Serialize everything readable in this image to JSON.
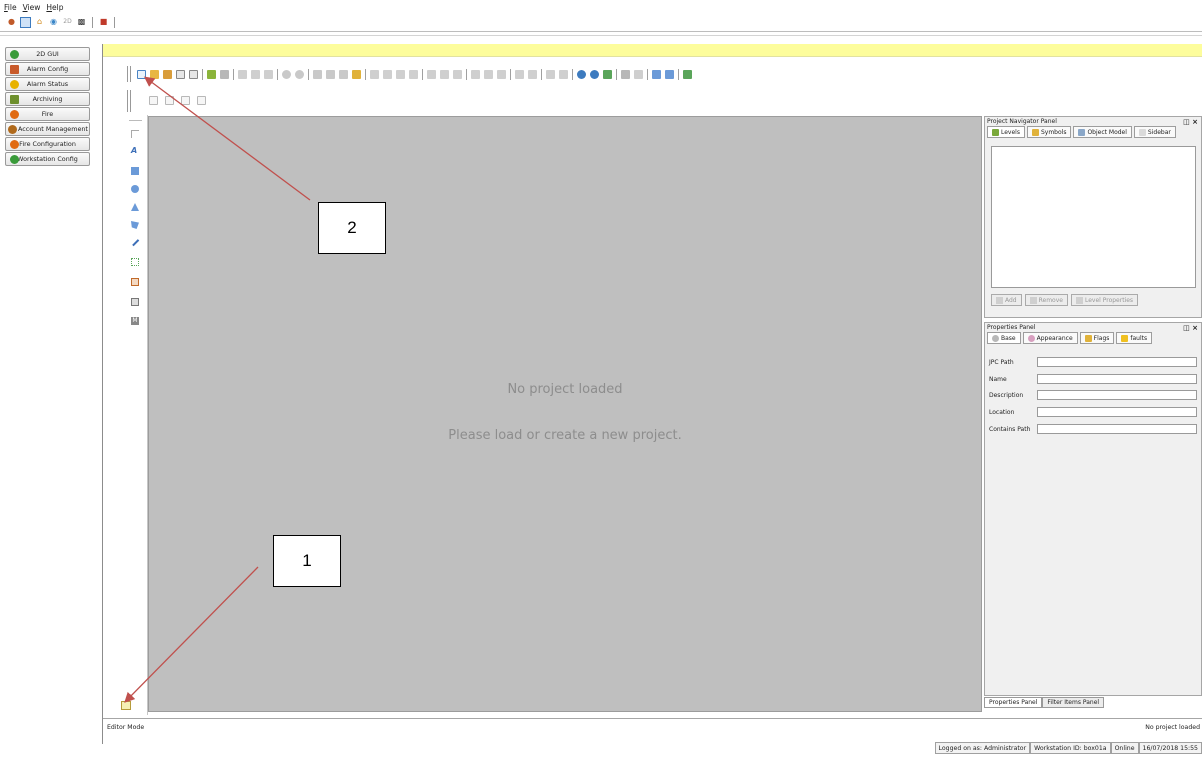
{
  "menubar": {
    "items": [
      "File",
      "View",
      "Help"
    ]
  },
  "system_toolbar": {
    "icons": [
      "user-icon",
      "monitor-icon",
      "home-icon",
      "globe-icon",
      "2d-icon",
      "binoculars-icon",
      "alarm-icon"
    ]
  },
  "nav": {
    "items": [
      {
        "label": "2D GUI",
        "icon": "globe-icon",
        "color": "#3a9b3a"
      },
      {
        "label": "Alarm Config",
        "icon": "wrench-icon",
        "color": "#c85a2a"
      },
      {
        "label": "Alarm Status",
        "icon": "star-icon",
        "color": "#e8b200"
      },
      {
        "label": "Archiving",
        "icon": "archive-icon",
        "color": "#6d8f2d"
      },
      {
        "label": "Fire",
        "icon": "fire-icon",
        "color": "#e06a12"
      },
      {
        "label": "Account Management",
        "icon": "users-icon",
        "color": "#b06a1c"
      },
      {
        "label": "Fire Configuration",
        "icon": "fire-icon",
        "color": "#e06a12"
      },
      {
        "label": "Workstation Config",
        "icon": "globe-icon",
        "color": "#3a9b3a"
      }
    ]
  },
  "canvas": {
    "message_title": "No project loaded",
    "message_body": "Please load or create a new project."
  },
  "navigator_panel": {
    "title": "Project Navigator Panel",
    "tabs": [
      "Levels",
      "Symbols",
      "Object Model",
      "Sidebar"
    ],
    "buttons": [
      "Add",
      "Remove",
      "Level Properties"
    ]
  },
  "properties_panel": {
    "title": "Properties Panel",
    "tabs": [
      "Base",
      "Appearance",
      "Flags",
      "faults"
    ],
    "fields": [
      {
        "label": "JPC Path",
        "value": ""
      },
      {
        "label": "Name",
        "value": ""
      },
      {
        "label": "Description",
        "value": ""
      },
      {
        "label": "Location",
        "value": ""
      },
      {
        "label": "Contains Path",
        "value": ""
      }
    ],
    "bottom_tabs": [
      "Properties Panel",
      "Filter Items Panel"
    ]
  },
  "status": {
    "mode": "Editor Mode",
    "project": "No project loaded",
    "logged_on": "Logged on as: Administrator",
    "workstation": "Workstation ID: box01a",
    "online": "Online",
    "datetime": "16/07/2018 15:55"
  },
  "annotations": {
    "callout_1": "1",
    "callout_2": "2",
    "arrow_color": "#c0504d"
  }
}
